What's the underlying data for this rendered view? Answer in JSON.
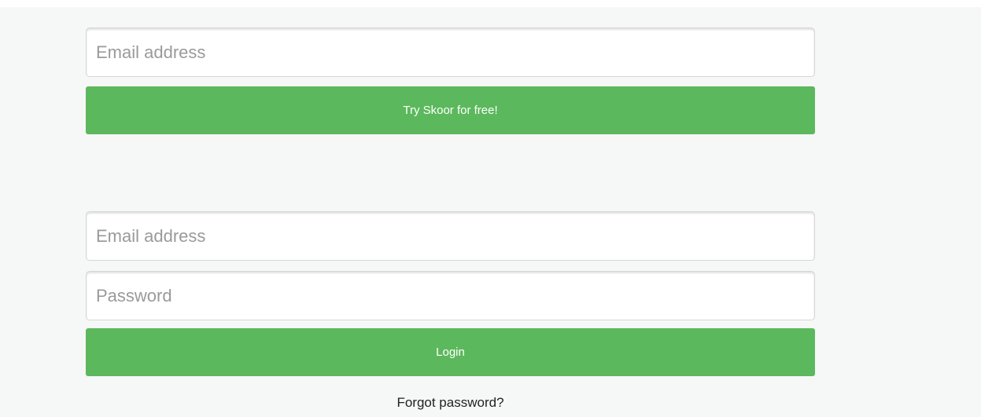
{
  "signup": {
    "email_placeholder": "Email address",
    "submit_label": "Try Skoor for free!"
  },
  "login": {
    "email_placeholder": "Email address",
    "password_placeholder": "Password",
    "submit_label": "Login",
    "forgot_password_label": "Forgot password?"
  },
  "colors": {
    "background": "#f6f7f7",
    "button_green": "#5cb85c",
    "button_text": "#ffffff",
    "placeholder": "#9a9a9a"
  }
}
